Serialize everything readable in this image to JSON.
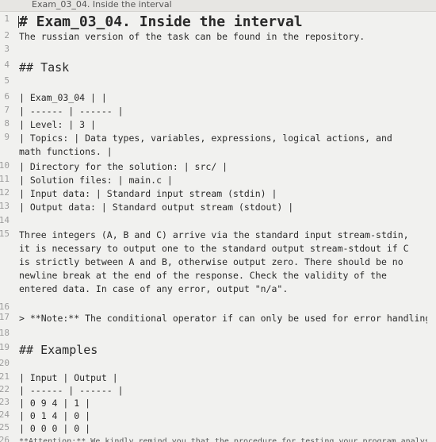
{
  "window": {
    "tab_title": "Exam_03_04. Inside the interval"
  },
  "editor": {
    "lines": [
      {
        "n": "1",
        "text": "# Exam_03_04. Inside the interval"
      },
      {
        "n": "2",
        "text": "The russian version of the task can be found in the repository."
      },
      {
        "n": "3",
        "text": ""
      },
      {
        "n": "4",
        "text": "## Task"
      },
      {
        "n": "5",
        "text": ""
      },
      {
        "n": "6",
        "text": "| Exam_03_04 | |"
      },
      {
        "n": "7",
        "text": "| ------ | ------ |"
      },
      {
        "n": "8",
        "text": "| Level: | 3 |"
      },
      {
        "n": "9",
        "text": "| Topics: | Data types, variables, expressions, logical actions, and math functions. |"
      },
      {
        "n": "10",
        "text": "| Directory for the solution: | src/ |"
      },
      {
        "n": "11",
        "text": "| Solution files: | main.c |"
      },
      {
        "n": "12",
        "text": "| Input data: | Standard input stream (stdin) |"
      },
      {
        "n": "13",
        "text": "| Output data: | Standard output stream (stdout) |"
      },
      {
        "n": "14",
        "text": ""
      },
      {
        "n": "15",
        "text": "Three integers (A, B and C) arrive via the standard input stream-stdin, it is necessary to output one to the standard output stream-stdout if C is strictly between A and B, otherwise output zero. There should be no newline break at the end of the response. Check the validity of the entered data. In case of any error, output \"n/a\"."
      },
      {
        "n": "16",
        "text": ""
      },
      {
        "n": "17",
        "text": "> **Note:** The conditional operator if can only be used for error handling"
      },
      {
        "n": "18",
        "text": ""
      },
      {
        "n": "19",
        "text": "## Examples"
      },
      {
        "n": "20",
        "text": ""
      },
      {
        "n": "21",
        "text": "| Input | Output |"
      },
      {
        "n": "22",
        "text": "| ------ | ------ |"
      },
      {
        "n": "23",
        "text": "| 0 9 4 | 1 |"
      },
      {
        "n": "24",
        "text": "| 0 1 4 | 0 |"
      },
      {
        "n": "25",
        "text": "| 0 0 0 | 0 |"
      },
      {
        "n": "26",
        "text": "**Attention:** We kindly remind you that the procedure for testing your program analysis of the code style. Please look in the \"materials /\" your program for memory leaks!"
      }
    ]
  }
}
